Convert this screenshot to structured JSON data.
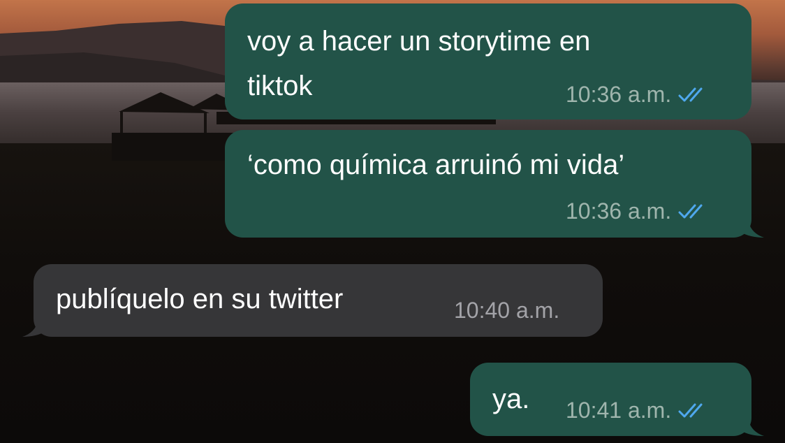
{
  "chat": {
    "messages": [
      {
        "direction": "outgoing",
        "text_line1": "voy a hacer un storytime en",
        "text_line2": "tiktok",
        "time": "10:36 a.m.",
        "status_icon": "double-check-read-icon"
      },
      {
        "direction": "outgoing",
        "text": "‘como química arruinó mi vida’",
        "time": "10:36 a.m.",
        "status_icon": "double-check-read-icon"
      },
      {
        "direction": "incoming",
        "text": "publíquelo en su twitter",
        "time": "10:40 a.m."
      },
      {
        "direction": "outgoing",
        "text": "ya.",
        "time": "10:41 a.m.",
        "status_icon": "double-check-read-icon"
      }
    ]
  },
  "colors": {
    "outgoing_bubble": "#225348",
    "incoming_bubble": "#363638",
    "read_ticks": "#4fa8ee"
  }
}
